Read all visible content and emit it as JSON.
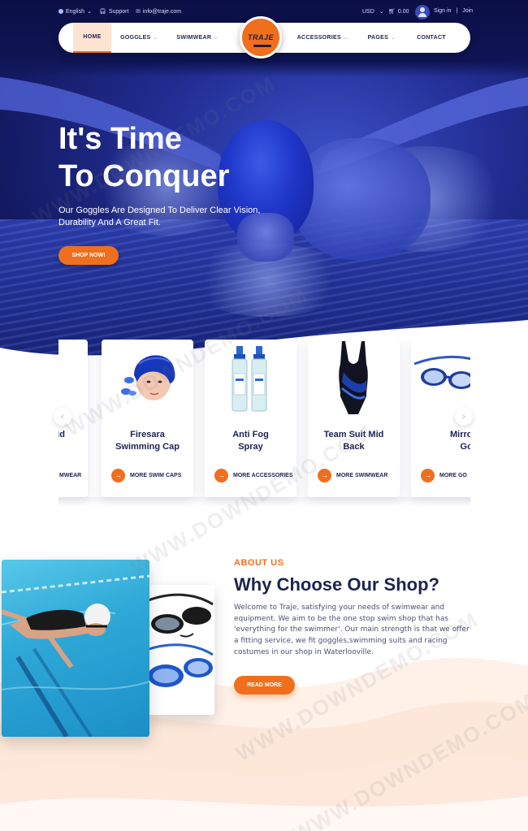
{
  "topbar": {
    "language": "English",
    "support": "Support",
    "email": "info@traje.com",
    "currency": "USD",
    "cart_total": "0.00",
    "sign_in": "Sign in",
    "separator": "|",
    "join": "Join"
  },
  "nav": {
    "items": [
      {
        "label": "HOME",
        "active": true
      },
      {
        "label": "GOGGLES",
        "has_dropdown": true
      },
      {
        "label": "SWIMWEAR",
        "has_dropdown": true
      },
      {
        "label": "ACCESSORIES",
        "has_dropdown": true
      },
      {
        "label": "PAGES",
        "has_dropdown": true
      },
      {
        "label": "CONTACT"
      }
    ],
    "logo_text": "TRAJE"
  },
  "hero": {
    "title_line1": "It's Time",
    "title_line2": "To Conquer",
    "subtitle": "Our Goggles Are Designed To Deliver Clear Vision, Durability And A Great Fit.",
    "cta": "SHOP NOW!"
  },
  "products": {
    "prev_icon": "‹",
    "next_icon": "›",
    "cards": [
      {
        "name_line1": "Mid",
        "name_line2": "",
        "link": "MWEAR"
      },
      {
        "name_line1": "Firesara",
        "name_line2": "Swimming Cap",
        "link": "MORE SWIM CAPS"
      },
      {
        "name_line1": "Anti Fog",
        "name_line2": "Spray",
        "link": "MORE ACCESSORIES"
      },
      {
        "name_line1": "Team Suit Mid",
        "name_line2": "Back",
        "link": "MORE SWIMWEAR"
      },
      {
        "name_line1": "Mirrored S",
        "name_line2": "Goggle",
        "link": "MORE GO"
      }
    ]
  },
  "about": {
    "kicker": "ABOUT US",
    "title": "Why Choose Our Shop?",
    "body": "Welcome to Traje, satisfying your needs of swimwear and equipment. We aim to be the one stop swim shop that has 'everything for the swimmer'. Our main strength is that we offer a fitting service, we fit goggles,swimming suits and racing costumes in our shop in Waterlooville.",
    "cta": "READ MORE"
  },
  "watermark": "WWW.DOWNDEMO.COM",
  "colors": {
    "accent": "#f06f1d",
    "navy": "#1c2450",
    "hero_blue": "#232f96"
  }
}
